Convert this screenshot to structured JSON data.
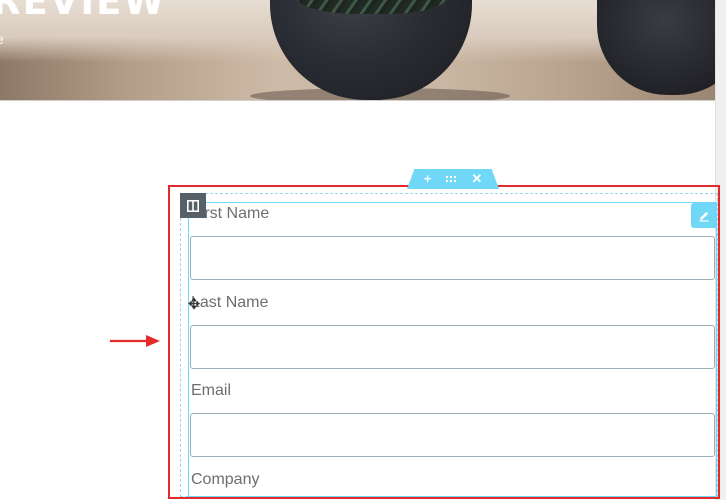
{
  "hero": {
    "title": "REVIEW",
    "subtitle": "e"
  },
  "editor": {
    "section_handle": {
      "add_icon": "plus-icon",
      "drag_icon": "drag-grip-icon",
      "delete_icon": "close-icon"
    },
    "column_handle_icon": "column-icon",
    "widget_edit_icon": "pencil-icon",
    "accent_color": "#71d7f7",
    "annotation_color": "#e32b2b"
  },
  "form": {
    "fields": [
      {
        "label": "First Name",
        "value": "",
        "placeholder": ""
      },
      {
        "label": "Last Name",
        "value": "",
        "placeholder": ""
      },
      {
        "label": "Email",
        "value": "",
        "placeholder": ""
      },
      {
        "label": "Company"
      }
    ]
  }
}
